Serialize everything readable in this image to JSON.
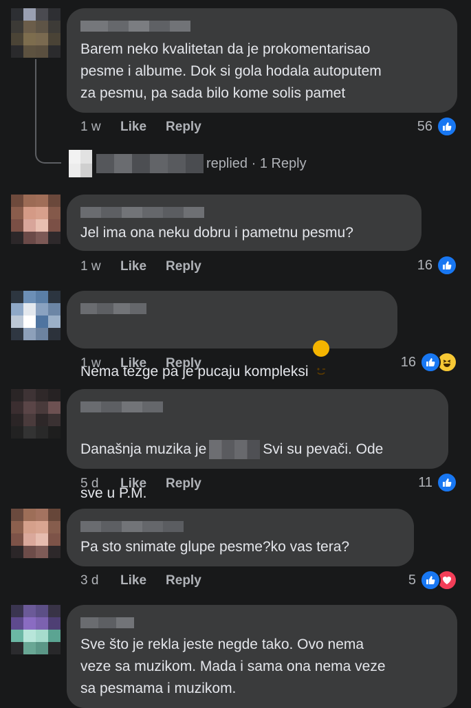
{
  "comments": [
    {
      "text": "Barem neko kvalitetan da je prokomentarisao\npesme i albume. Dok si gola hodala autoputem\nza pesmu, pa sada bilo kome solis pamet",
      "time": "1 w",
      "like": "Like",
      "reply": "Reply",
      "count": "56",
      "avatar_icon": "blurred-avatar-icon"
    },
    {
      "text": "Jel ima ona neku dobru i pametnu pesmu?",
      "time": "1 w",
      "like": "Like",
      "reply": "Reply",
      "count": "16",
      "avatar_icon": "blurred-avatar-icon"
    },
    {
      "text": "Nema tezge pa je pucaju kompleksi",
      "time": "1 w",
      "like": "Like",
      "reply": "Reply",
      "count": "16",
      "avatar_icon": "blurred-avatar-icon"
    },
    {
      "text_a": "Današnja muzika je",
      "text_b": "Svi su pevači. Ode",
      "text_c": "sve u P.M.",
      "time": "5 d",
      "like": "Like",
      "reply": "Reply",
      "count": "11",
      "avatar_icon": "blurred-avatar-icon"
    },
    {
      "text": "Pa sto snimate glupe pesme?ko vas tera?",
      "time": "3 d",
      "like": "Like",
      "reply": "Reply",
      "count": "5",
      "avatar_icon": "blurred-avatar-icon"
    },
    {
      "text": "Sve što je rekla jeste negde tako. Ovo nema\nveze sa muzikom. Mada i sama ona nema veze\nsa pesmama i muzikom.",
      "avatar_icon": "blurred-avatar-icon"
    }
  ],
  "reply_thread": {
    "label": "replied · 1 Reply"
  },
  "colors": {
    "background": "#18191a",
    "bubble": "#3a3b3c",
    "text": "#e4e6eb",
    "muted": "#b0b3b8",
    "like_blue": "#1877f2",
    "love_red": "#f33e58",
    "haha_yellow": "#f7c835"
  }
}
